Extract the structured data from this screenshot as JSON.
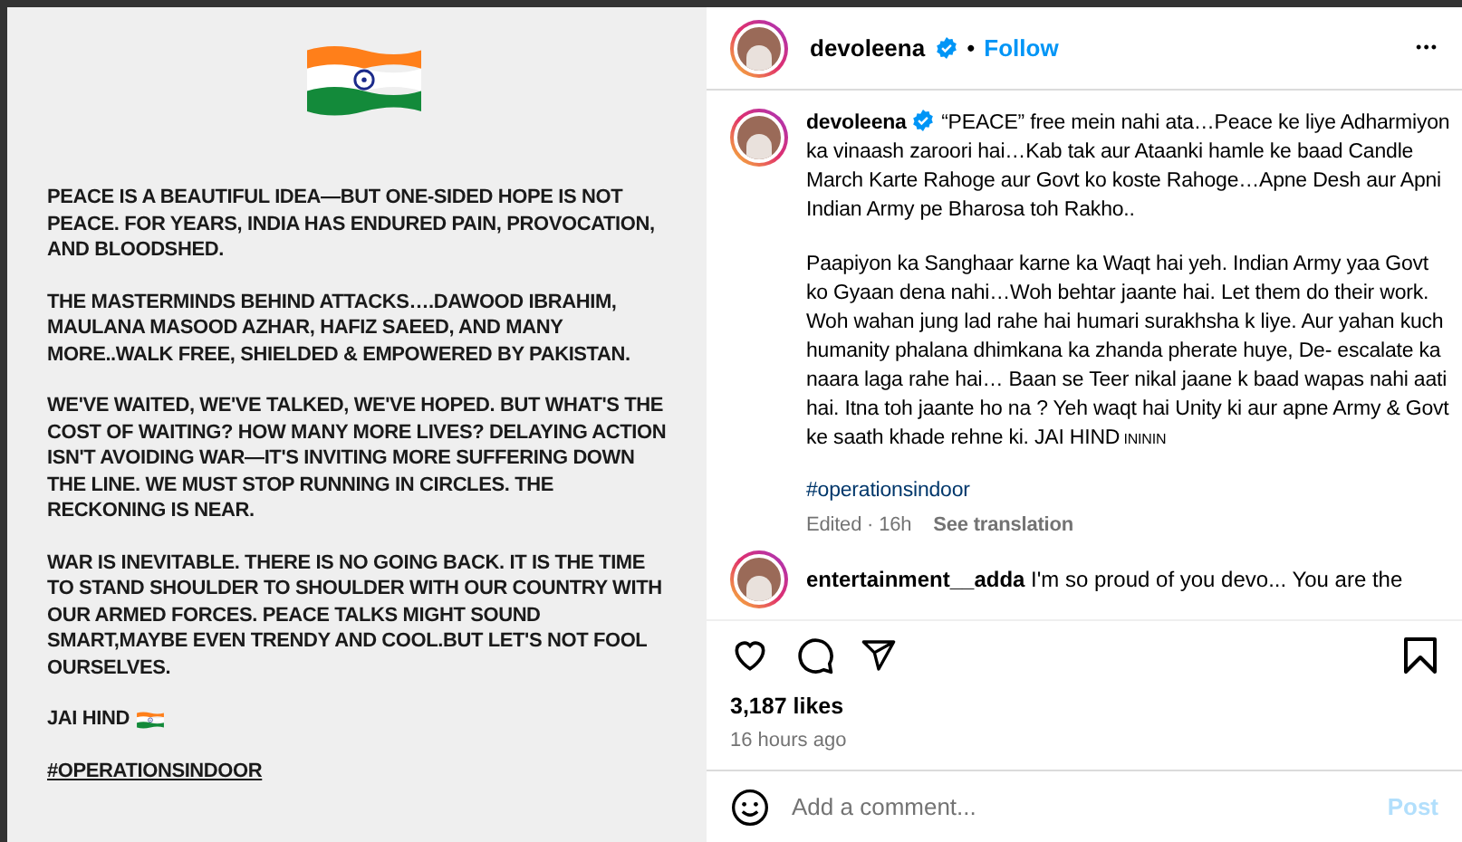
{
  "post_image": {
    "paragraphs": [
      "PEACE IS A BEAUTIFUL IDEA—BUT ONE-SIDED HOPE IS NOT PEACE. FOR YEARS, INDIA HAS ENDURED PAIN, PROVOCATION, AND BLOODSHED.",
      "THE MASTERMINDS BEHIND ATTACKS….DAWOOD IBRAHIM, MAULANA MASOOD AZHAR, HAFIZ SAEED, AND MANY MORE..WALK FREE, SHIELDED & EMPOWERED BY PAKISTAN.",
      "WE'VE WAITED, WE'VE TALKED, WE'VE HOPED. BUT WHAT'S THE COST OF WAITING? HOW MANY MORE LIVES? DELAYING ACTION ISN'T AVOIDING WAR—IT'S INVITING MORE SUFFERING DOWN THE LINE. WE MUST STOP RUNNING IN CIRCLES. THE RECKONING IS NEAR.",
      "WAR IS INEVITABLE. THERE IS NO GOING BACK. IT IS THE TIME TO STAND SHOULDER TO SHOULDER WITH OUR COUNTRY WITH OUR ARMED FORCES. PEACE TALKS MIGHT SOUND SMART,MAYBE EVEN TRENDY AND COOL.BUT LET'S NOT FOOL OURSELVES."
    ],
    "signoff": "JAI HIND",
    "hashtag": "#OPERATIONSINDOOR"
  },
  "header": {
    "username": "devoleena",
    "verified": true,
    "separator": "•",
    "follow": "Follow",
    "more": "•••"
  },
  "caption": {
    "username": "devoleena",
    "verified": true,
    "paragraphs": [
      "“PEACE” free mein nahi ata…Peace ke liye Adharmiyon ka vinaash zaroori hai…Kab tak aur Ataanki hamle ke baad Candle March Karte Rahoge aur Govt ko koste Rahoge…Apne Desh aur Apni Indian Army pe Bharosa toh Rakho..",
      "Paapiyon ka Sanghaar karne ka Waqt hai yeh. Indian Army yaa Govt ko Gyaan dena nahi…Woh behtar jaante hai. Let them do their work. Woh wahan jung lad rahe hai humari surakhsha k liye. Aur yahan kuch humanity phalana dhimkana ka zhanda pherate huye, De- escalate ka naara laga rahe hai… Baan se Teer nikal jaane k baad wapas nahi aati hai. Itna toh jaante ho na ? Yeh waqt hai Unity ki aur apne Army & Govt ke saath khade rehne ki. JAI HIND"
    ],
    "flag_letters": "INININ",
    "hashtag": "#operationsindoor",
    "edited": "Edited · 16h",
    "translate": "See translation"
  },
  "comments": [
    {
      "username": "entertainment__adda",
      "text": "I'm so proud of you devo... You are the"
    }
  ],
  "actions": {
    "liked": false,
    "saved": false
  },
  "likes": "3,187 likes",
  "time": "16 hours ago",
  "comment_field": {
    "placeholder": "Add a comment...",
    "post": "Post"
  }
}
